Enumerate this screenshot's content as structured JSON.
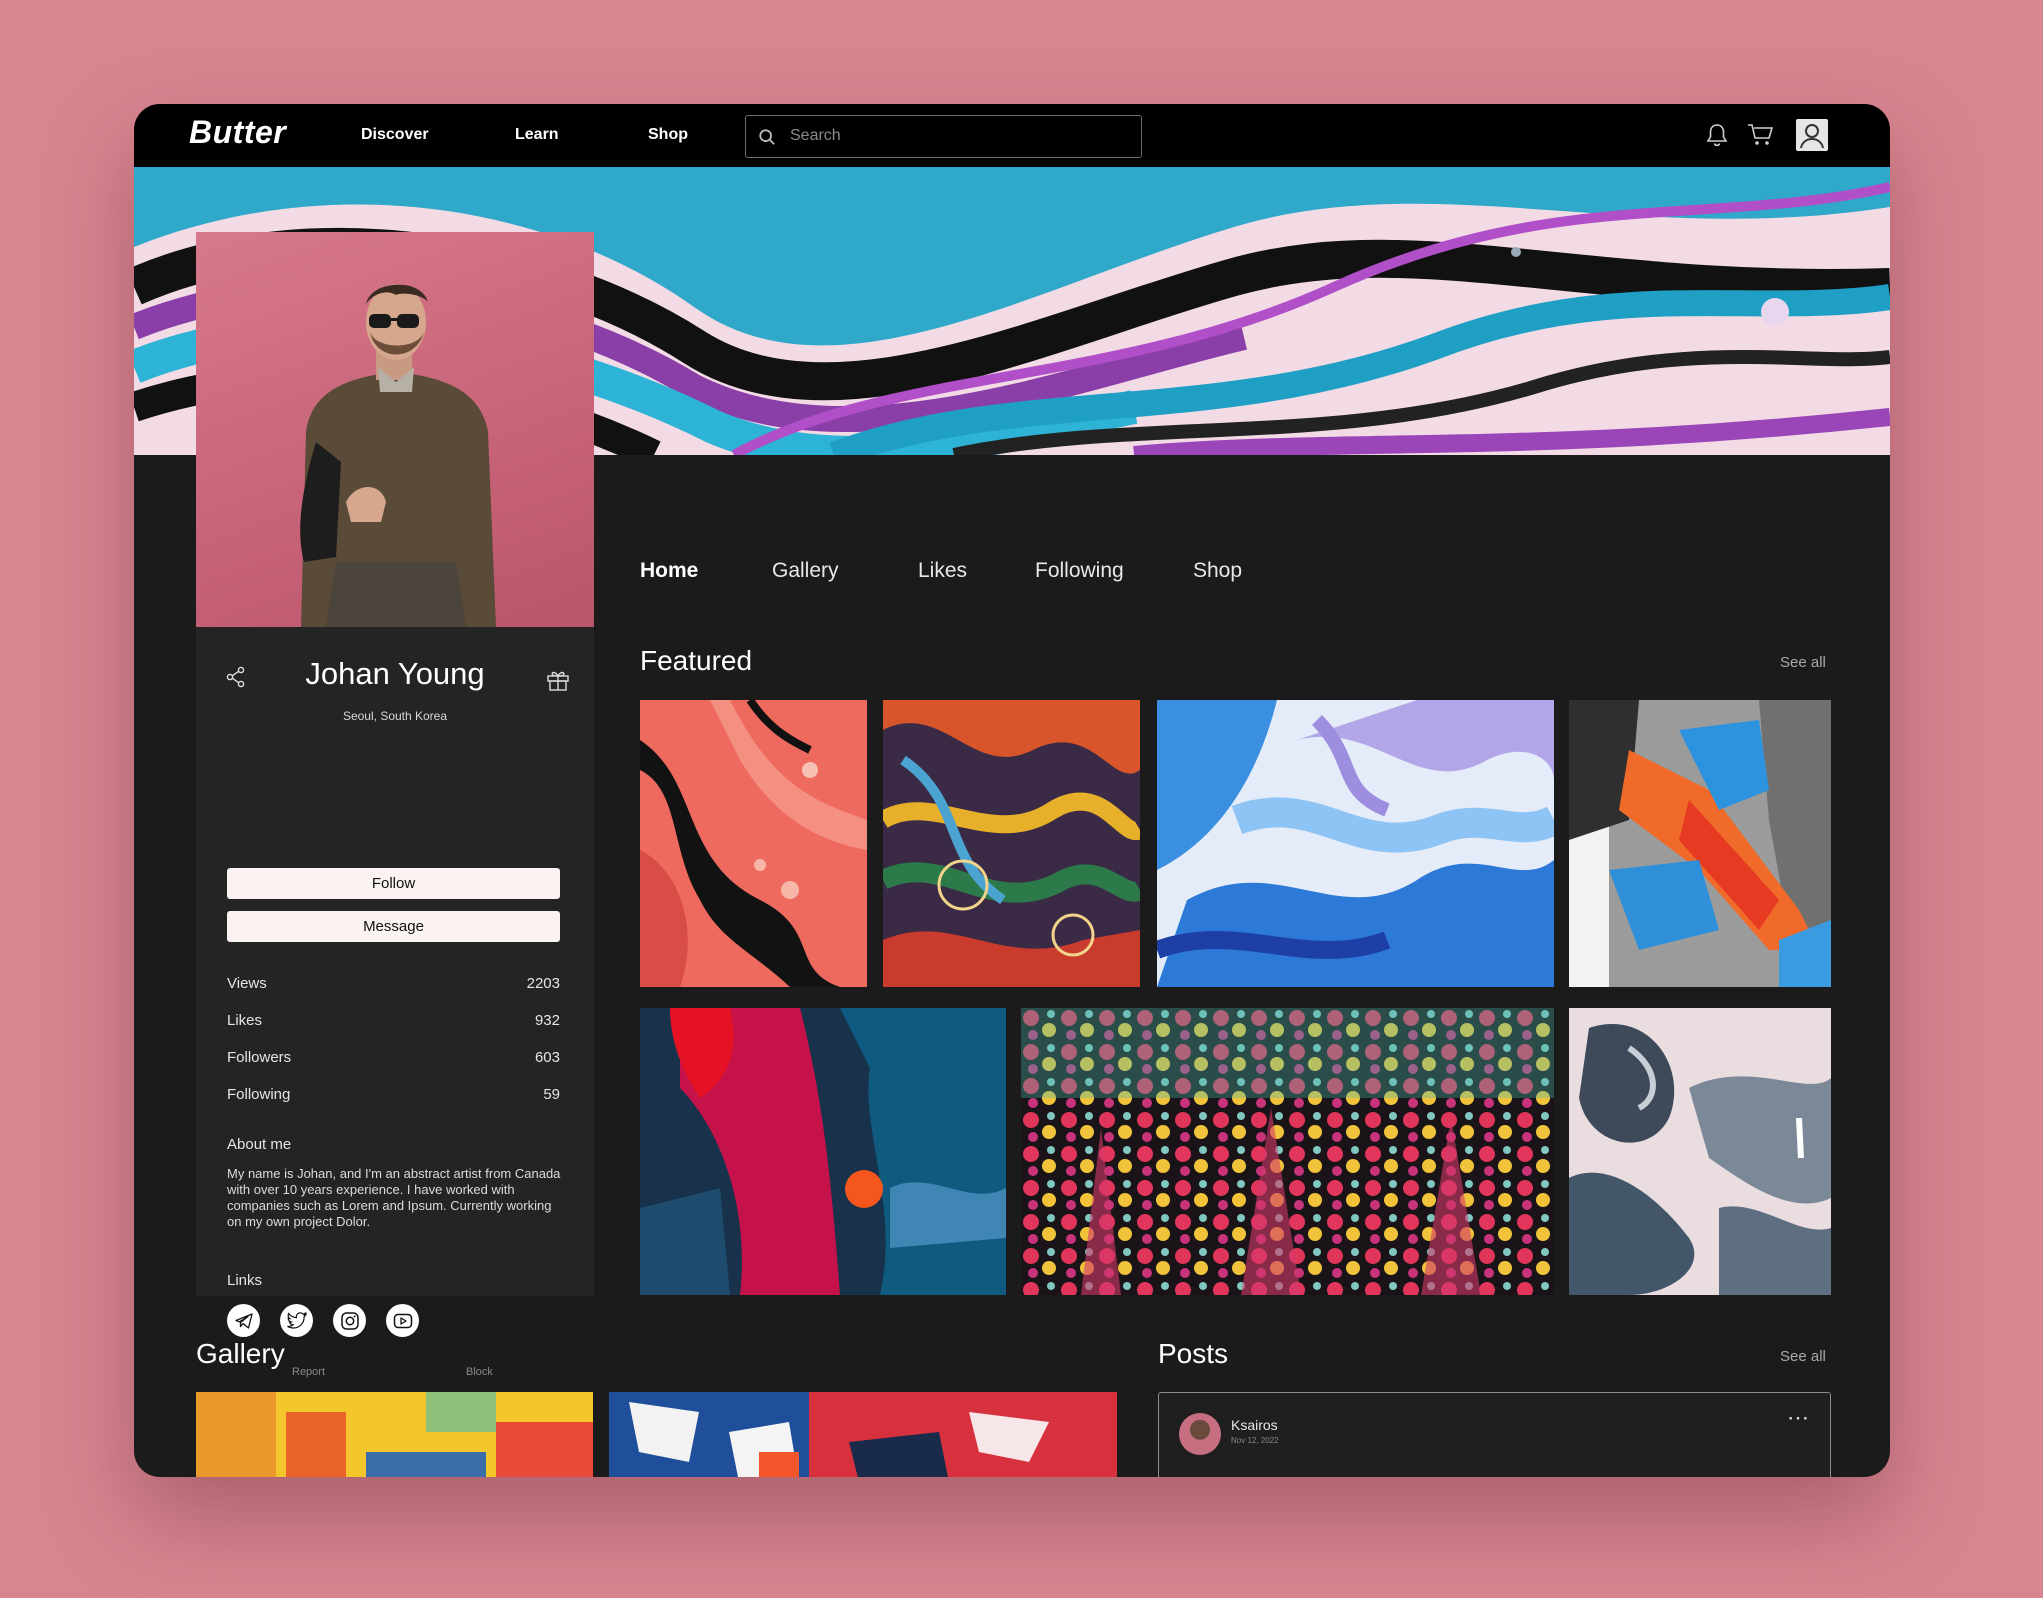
{
  "nav": {
    "brand": "Butter",
    "links": [
      "Discover",
      "Learn",
      "Shop"
    ],
    "search_placeholder": "Search",
    "icons": [
      "bell-icon",
      "cart-icon",
      "user-icon"
    ]
  },
  "profile": {
    "name": "Johan Young",
    "location": "Seoul, South Korea",
    "follow_label": "Follow",
    "message_label": "Message",
    "stats": [
      {
        "label": "Views",
        "value": "2203"
      },
      {
        "label": "Likes",
        "value": "932"
      },
      {
        "label": "Followers",
        "value": "603"
      },
      {
        "label": "Following",
        "value": "59"
      }
    ],
    "about_heading": "About me",
    "about_text": "My name is Johan, and I'm an abstract artist from Canada with over 10 years experience. I have worked with companies such as Lorem and Ipsum. Currently working on my own project Dolor.",
    "links_heading": "Links",
    "socials": [
      "telegram-icon",
      "twitter-icon",
      "instagram-icon",
      "youtube-icon"
    ],
    "report_label": "Report",
    "block_label": "Block"
  },
  "tabs": [
    "Home",
    "Gallery",
    "Likes",
    "Following",
    "Shop"
  ],
  "active_tab": "Home",
  "featured": {
    "heading": "Featured",
    "see_all": "See all"
  },
  "gallery": {
    "heading": "Gallery"
  },
  "posts": {
    "heading": "Posts",
    "see_all": "See all",
    "items": [
      {
        "user": "Ksairos",
        "date": "Nov 12, 2022"
      }
    ]
  }
}
